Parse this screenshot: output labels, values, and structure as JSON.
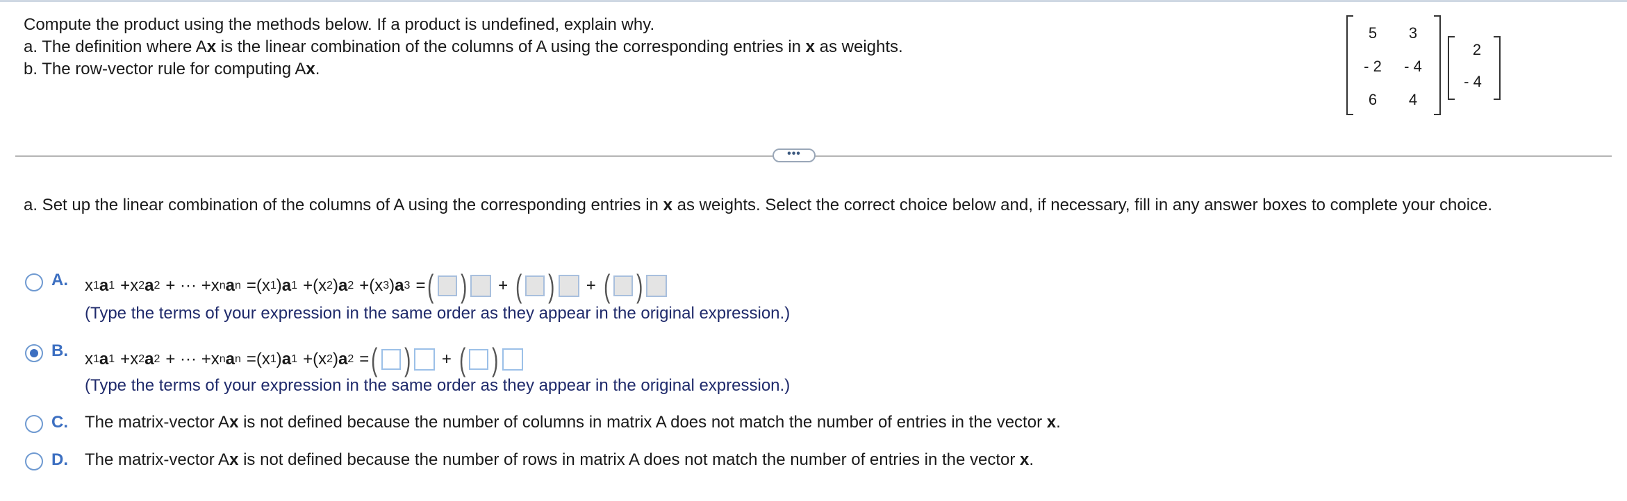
{
  "prompt": {
    "line1": "Compute the product using the methods below. If a product is undefined, explain why.",
    "line2_pre": "a. The definition where A",
    "line2_bold": "x",
    "line2_post": " is the linear combination of the columns of A using the corresponding entries in ",
    "line2_bold2": "x",
    "line2_end": " as weights.",
    "line3_pre": "b. The row-vector rule for computing A",
    "line3_bold": "x",
    "line3_end": "."
  },
  "matrix_A": {
    "rows": [
      [
        "5",
        "3"
      ],
      [
        "- 2",
        "- 4"
      ],
      [
        "6",
        "4"
      ]
    ]
  },
  "vector_x": {
    "entries": [
      "2",
      "- 4"
    ]
  },
  "more_button": "•••",
  "part_a": {
    "instruction_pre": "a. Set up the linear combination of the columns of A using the corresponding entries in ",
    "instruction_bold": "x",
    "instruction_post": " as weights. Select the correct choice below and, if necessary, fill in any answer boxes to complete your choice."
  },
  "choices": {
    "A": {
      "letter": "A.",
      "selected": false,
      "hint": "(Type the terms of your expression in the same order as they appear in the original expression.)"
    },
    "B": {
      "letter": "B.",
      "selected": true,
      "hint": "(Type the terms of your expression in the same order as they appear in the original expression.)"
    },
    "C": {
      "letter": "C.",
      "selected": false,
      "text_pre": "The matrix-vector A",
      "text_bold": "x",
      "text_mid": " is not defined because the number of columns in matrix A does not match the number of entries in the vector ",
      "text_bold2": "x",
      "text_end": "."
    },
    "D": {
      "letter": "D.",
      "selected": false,
      "text_pre": "The matrix-vector A",
      "text_bold": "x",
      "text_mid": " is not defined because the number of rows in matrix A does not match the number of entries in the vector ",
      "text_bold2": "x",
      "text_end": "."
    }
  },
  "colors": {
    "accent": "#3c6fc1",
    "hint_text": "#1f2a6b",
    "answer_box_border": "#9cc0e8",
    "answer_box_fill": "#e4e4e4"
  }
}
